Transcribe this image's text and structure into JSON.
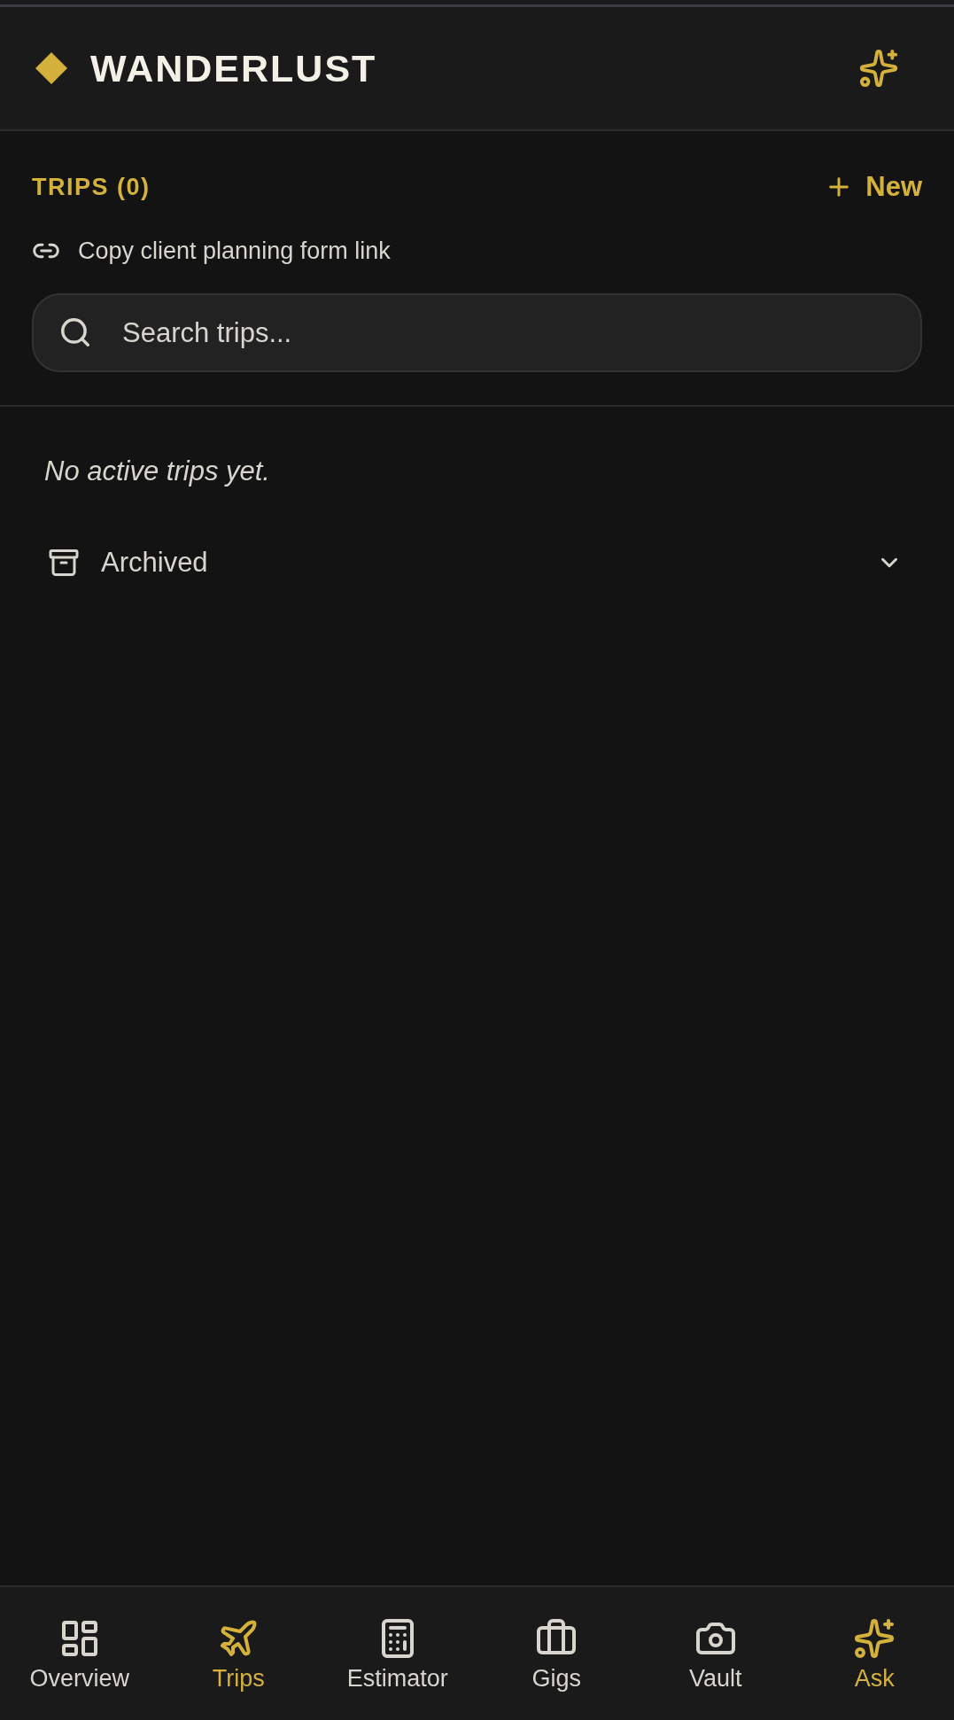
{
  "header": {
    "title": "WANDERLUST"
  },
  "trips": {
    "heading": "TRIPS (0)",
    "new_button": "New",
    "copy_link": "Copy client planning form link",
    "search": {
      "placeholder": "Search trips..."
    },
    "empty_message": "No active trips yet.",
    "archived": {
      "label": "Archived",
      "expanded": false
    }
  },
  "bottom_nav": [
    {
      "kind": "tab",
      "label": "Overview",
      "selected": false
    },
    {
      "kind": "tab",
      "label": "Trips",
      "selected": true
    },
    {
      "kind": "tab",
      "label": "Estimator",
      "selected": false
    },
    {
      "kind": "tab",
      "label": "Gigs",
      "selected": false
    },
    {
      "kind": "tab",
      "label": "Vault",
      "selected": false
    },
    {
      "kind": "action",
      "label": "Ask"
    }
  ]
}
